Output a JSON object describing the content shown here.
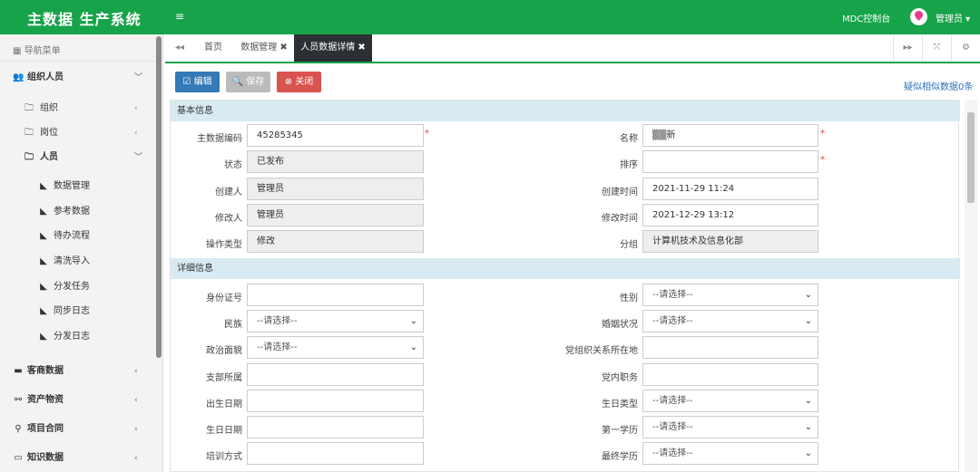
{
  "header": {
    "brand": "主数据 生产系统",
    "menu_icon": "≡",
    "console": "MDC控制台",
    "user": "管理员 ▾",
    "avatar_icon": "location-pin-icon"
  },
  "sidebar": {
    "title": "导航菜单",
    "groups": [
      {
        "label": "组织人员",
        "chevron": "﹀"
      },
      {
        "label": "组织",
        "chevron": "‹"
      },
      {
        "label": "岗位",
        "chevron": "‹"
      },
      {
        "label": "人员",
        "chevron": "﹀"
      },
      {
        "label": "数据管理"
      },
      {
        "label": "参考数据"
      },
      {
        "label": "待办流程"
      },
      {
        "label": "清洗导入"
      },
      {
        "label": "分发任务"
      },
      {
        "label": "同步日志"
      },
      {
        "label": "分发日志"
      },
      {
        "label": "客商数据",
        "chevron": "‹"
      },
      {
        "label": "资产物资",
        "chevron": "‹"
      },
      {
        "label": "项目合同",
        "chevron": "‹"
      },
      {
        "label": "知识数据",
        "chevron": "‹"
      }
    ]
  },
  "tabs": {
    "home": "首页",
    "data_mgmt": "数据管理 ✖",
    "person_detail": "人员数据详情 ✖",
    "prev": "◂◂",
    "next": "▸▸",
    "expand": "⤧",
    "settings": "⚙"
  },
  "toolbar": {
    "edit": "☑ 编辑",
    "save": "🔍 保存",
    "close": "⊗ 关闭",
    "similar": "疑似相似数据0条"
  },
  "colors": {
    "brand_green": "#17a34a",
    "edit_blue": "#337ab7",
    "close_red": "#d9534f",
    "save_gray": "#bbbbbb"
  },
  "basic": {
    "section": "基本信息",
    "code_label": "主数据编码",
    "code_value": "45285345",
    "name_label": "名称",
    "name_value": "▒▒新",
    "status_label": "状态",
    "status_value": "已发布",
    "order_label": "排序",
    "order_value": "",
    "creator_label": "创建人",
    "creator_value": "管理员",
    "created_label": "创建时间",
    "created_value": "2021-11-29 11:24",
    "modifier_label": "修改人",
    "modifier_value": "管理员",
    "modified_label": "修改时间",
    "modified_value": "2021-12-29 13:12",
    "op_label": "操作类型",
    "op_value": "修改",
    "group_label": "分组",
    "group_value": "计算机技术及信息化部",
    "required_mark": "*"
  },
  "detail": {
    "section": "详细信息",
    "select_placeholder": "--请选择--",
    "id_label": "身份证号",
    "gender_label": "性别",
    "ethnic_label": "民族",
    "marital_label": "婚姻状况",
    "political_label": "政治面貌",
    "party_org_label": "党组织关系所在地",
    "branch_label": "支部所属",
    "party_duty_label": "党内职务",
    "birth_label": "出生日期",
    "bday_type_label": "生日类型",
    "bday_label": "生日日期",
    "first_edu_label": "第一学历",
    "training_label": "培训方式",
    "final_edu_label": "最终学历"
  }
}
